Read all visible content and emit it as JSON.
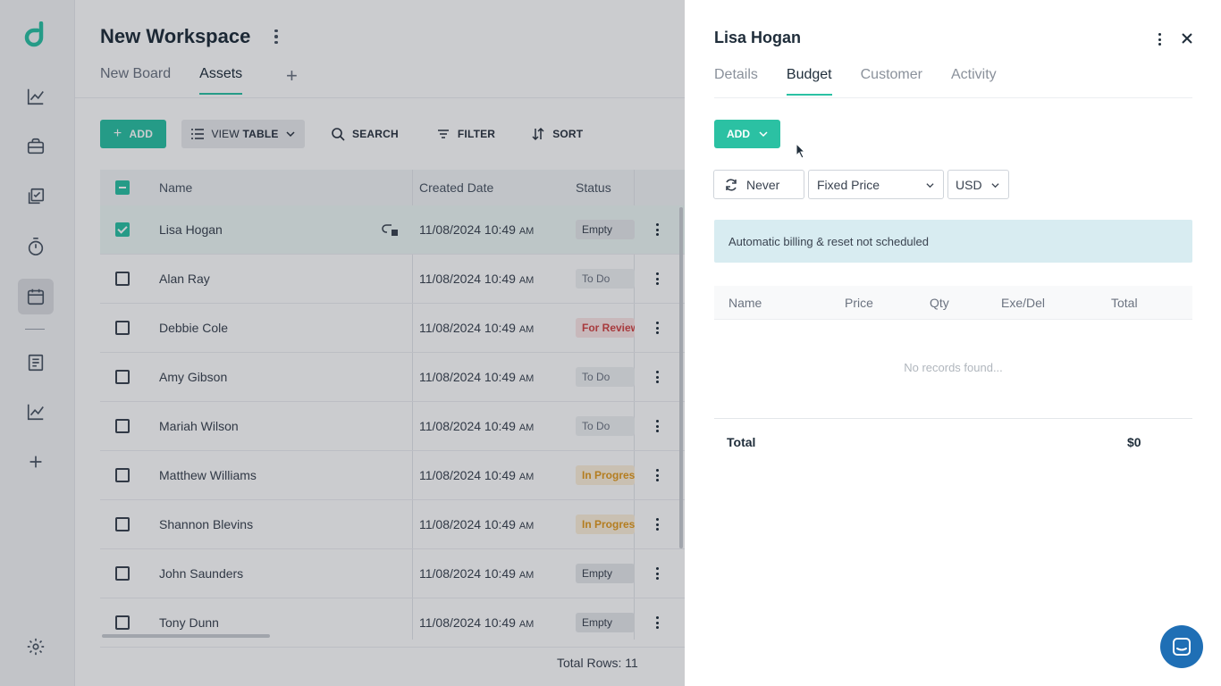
{
  "sidebar": {
    "items": [
      "dashboard-icon",
      "briefcase-icon",
      "tasks-icon",
      "timer-icon",
      "calendar-icon",
      "document-icon",
      "analytics-icon",
      "plus-icon"
    ],
    "settings_icon": "gear-icon"
  },
  "workspace": {
    "title": "New Workspace",
    "tabs": [
      {
        "label": "New Board",
        "active": false
      },
      {
        "label": "Assets",
        "active": true
      }
    ],
    "add_tab": "+"
  },
  "toolbar": {
    "add_label": "ADD",
    "view_prefix": "VIEW",
    "view_label": "TABLE",
    "search_label": "SEARCH",
    "filter_label": "FILTER",
    "sort_label": "SORT"
  },
  "table": {
    "headers": {
      "name": "Name",
      "created": "Created Date",
      "status": "Status"
    },
    "rows": [
      {
        "name": "Lisa Hogan",
        "date": "11/08/2024 10:49",
        "ampm": "AM",
        "status": "Empty",
        "status_kind": "empty",
        "checked": true
      },
      {
        "name": "Alan Ray",
        "date": "11/08/2024 10:49",
        "ampm": "AM",
        "status": "To Do",
        "status_kind": "todo",
        "checked": false
      },
      {
        "name": "Debbie Cole",
        "date": "11/08/2024 10:49",
        "ampm": "AM",
        "status": "For Review",
        "status_kind": "review",
        "checked": false
      },
      {
        "name": "Amy Gibson",
        "date": "11/08/2024 10:49",
        "ampm": "AM",
        "status": "To Do",
        "status_kind": "todo",
        "checked": false
      },
      {
        "name": "Mariah Wilson",
        "date": "11/08/2024 10:49",
        "ampm": "AM",
        "status": "To Do",
        "status_kind": "todo",
        "checked": false
      },
      {
        "name": "Matthew Williams",
        "date": "11/08/2024 10:49",
        "ampm": "AM",
        "status": "In Progress",
        "status_kind": "progress",
        "checked": false
      },
      {
        "name": "Shannon Blevins",
        "date": "11/08/2024 10:49",
        "ampm": "AM",
        "status": "In Progress",
        "status_kind": "progress",
        "checked": false
      },
      {
        "name": "John Saunders",
        "date": "11/08/2024 10:49",
        "ampm": "AM",
        "status": "Empty",
        "status_kind": "empty",
        "checked": false
      },
      {
        "name": "Tony Dunn",
        "date": "11/08/2024 10:49",
        "ampm": "AM",
        "status": "Empty",
        "status_kind": "empty",
        "checked": false
      }
    ],
    "total_rows": "Total Rows: 11"
  },
  "panel": {
    "title": "Lisa Hogan",
    "tabs": [
      {
        "label": "Details",
        "active": false
      },
      {
        "label": "Budget",
        "active": true
      },
      {
        "label": "Customer",
        "active": false
      },
      {
        "label": "Activity",
        "active": false
      }
    ],
    "add_label": "ADD",
    "recurrence": "Never",
    "pricing": "Fixed Price",
    "currency": "USD",
    "notice": "Automatic billing & reset not scheduled",
    "budget_headers": [
      "Name",
      "Price",
      "Qty",
      "Exe/Del",
      "Total"
    ],
    "empty_text": "No records found...",
    "total_label": "Total",
    "total_value": "$0"
  },
  "colors": {
    "accent": "#2bc1a3",
    "notice_bg": "#d8ecf1",
    "chat_bg": "#1f6fb5"
  }
}
